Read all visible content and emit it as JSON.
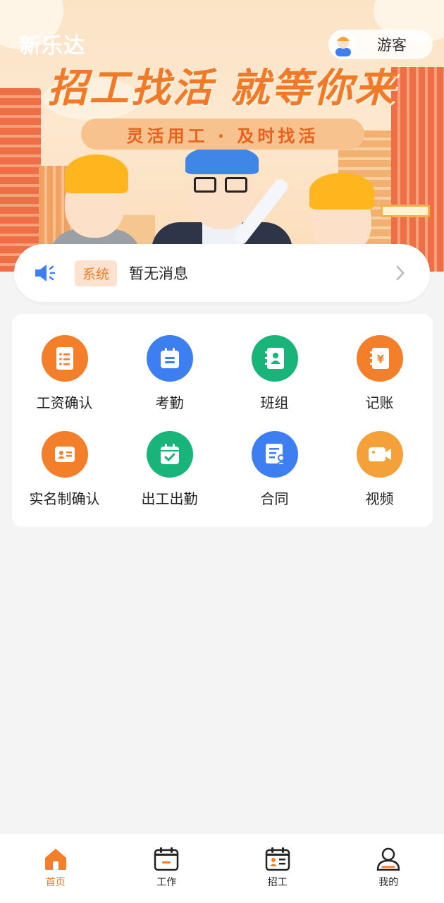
{
  "header": {
    "app_name": "新乐达",
    "user_name": "游客"
  },
  "banner": {
    "headline": "招工找活 就等你来",
    "subtitle": "灵活用工 · 及时找活"
  },
  "notice": {
    "tag": "系统",
    "message": "暂无消息"
  },
  "features": [
    {
      "label": "工资确认",
      "icon": "payslip-icon",
      "color": "#f47f2a"
    },
    {
      "label": "考勤",
      "icon": "calendar-icon",
      "color": "#3d7ef1"
    },
    {
      "label": "班组",
      "icon": "contact-book-icon",
      "color": "#19b47a"
    },
    {
      "label": "记账",
      "icon": "ledger-yuan-icon",
      "color": "#f47f2a"
    },
    {
      "label": "实名制确认",
      "icon": "id-card-icon",
      "color": "#f47f2a"
    },
    {
      "label": "出工出勤",
      "icon": "calendar-check-icon",
      "color": "#19b47a"
    },
    {
      "label": "合同",
      "icon": "contract-icon",
      "color": "#3d7ef1"
    },
    {
      "label": "视频",
      "icon": "video-camera-icon",
      "color": "#f5a13a"
    }
  ],
  "tabbar": {
    "items": [
      {
        "label": "首页",
        "icon": "home-icon"
      },
      {
        "label": "工作",
        "icon": "work-calendar-icon"
      },
      {
        "label": "招工",
        "icon": "recruit-icon"
      },
      {
        "label": "我的",
        "icon": "profile-icon"
      }
    ],
    "active_index": 0
  },
  "colors": {
    "accent": "#f07a28",
    "background": "#f4f4f4"
  }
}
